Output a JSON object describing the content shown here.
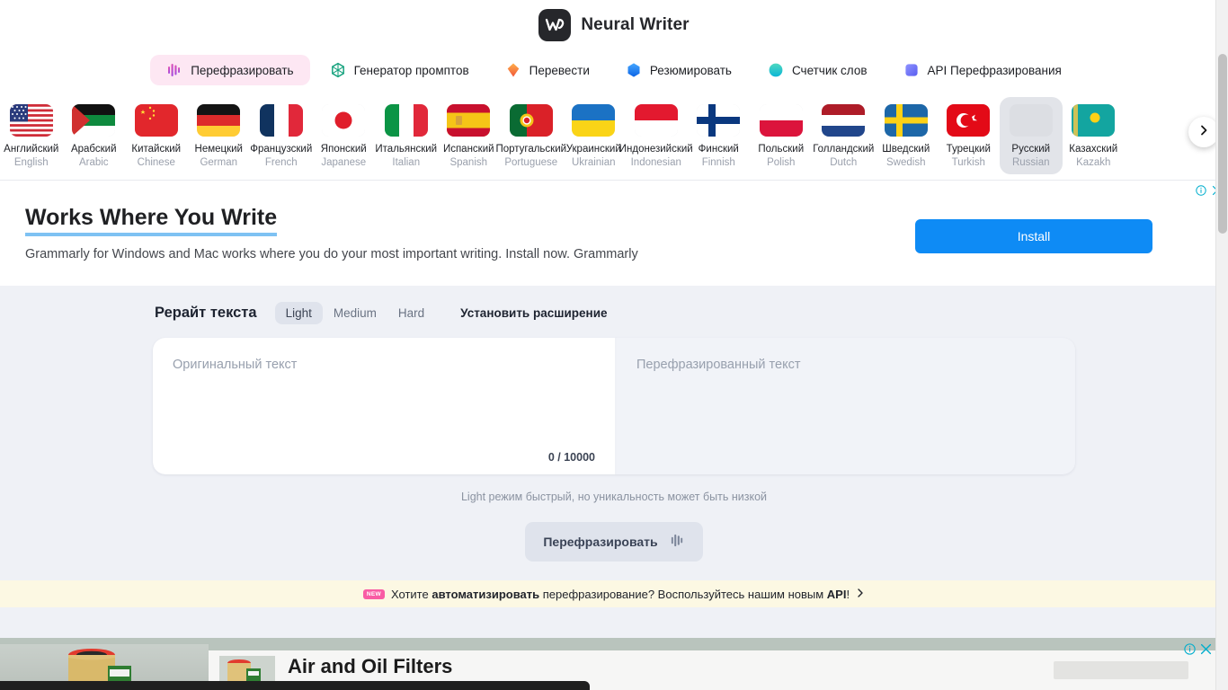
{
  "header": {
    "brand": "Neural Writer",
    "logo_icon": "neural-writer-logo"
  },
  "tabs": [
    {
      "label": "Перефразировать",
      "icon": "paraphrase-icon",
      "active": true
    },
    {
      "label": "Генератор промптов",
      "icon": "prompt-generator-icon",
      "active": false
    },
    {
      "label": "Перевести",
      "icon": "translate-icon",
      "active": false
    },
    {
      "label": "Резюмировать",
      "icon": "summarize-icon",
      "active": false
    },
    {
      "label": "Счетчик слов",
      "icon": "word-counter-icon",
      "active": false
    },
    {
      "label": "API Перефразирования",
      "icon": "api-icon",
      "active": false
    }
  ],
  "languages": [
    {
      "ru": "Английский",
      "en": "English",
      "flag": "us",
      "selected": false
    },
    {
      "ru": "Арабский",
      "en": "Arabic",
      "flag": "ps",
      "selected": false
    },
    {
      "ru": "Китайский",
      "en": "Chinese",
      "flag": "cn",
      "selected": false
    },
    {
      "ru": "Немецкий",
      "en": "German",
      "flag": "de",
      "selected": false
    },
    {
      "ru": "Французский",
      "en": "French",
      "flag": "fr",
      "selected": false
    },
    {
      "ru": "Японский",
      "en": "Japanese",
      "flag": "jp",
      "selected": false
    },
    {
      "ru": "Итальянский",
      "en": "Italian",
      "flag": "it",
      "selected": false
    },
    {
      "ru": "Испанский",
      "en": "Spanish",
      "flag": "es",
      "selected": false
    },
    {
      "ru": "Португальский",
      "en": "Portuguese",
      "flag": "pt",
      "selected": false
    },
    {
      "ru": "Украинский",
      "en": "Ukrainian",
      "flag": "ua",
      "selected": false
    },
    {
      "ru": "Индонезийский",
      "en": "Indonesian",
      "flag": "id",
      "selected": false
    },
    {
      "ru": "Финский",
      "en": "Finnish",
      "flag": "fi",
      "selected": false
    },
    {
      "ru": "Польский",
      "en": "Polish",
      "flag": "pl",
      "selected": false
    },
    {
      "ru": "Голландский",
      "en": "Dutch",
      "flag": "nl",
      "selected": false
    },
    {
      "ru": "Шведский",
      "en": "Swedish",
      "flag": "se",
      "selected": false
    },
    {
      "ru": "Турецкий",
      "en": "Turkish",
      "flag": "tr",
      "selected": false
    },
    {
      "ru": "Русский",
      "en": "Russian",
      "flag": "ru",
      "selected": true
    },
    {
      "ru": "Казахский",
      "en": "Kazakh",
      "flag": "kz",
      "selected": false
    }
  ],
  "flags_next_icon": "chevron-right-icon",
  "ad_top": {
    "title": "Works Where You Write",
    "description": "Grammarly for Windows and Mac works where you do your most important writing. Install now. Grammarly",
    "button": "Install",
    "info_icon": "ad-info-icon",
    "close_icon": "ad-close-icon",
    "accent": "#0e8bf5",
    "underline": "#7ec2f3"
  },
  "tool": {
    "title": "Рерайт текста",
    "modes": [
      {
        "label": "Light",
        "active": true
      },
      {
        "label": "Medium",
        "active": false
      },
      {
        "label": "Hard",
        "active": false
      }
    ],
    "extension_link": "Установить расширение",
    "input_placeholder": "Оригинальный текст",
    "output_placeholder": "Перефразированный текст",
    "counter": "0 / 10000",
    "hint": "Light режим быстрый, но уникальность может быть низкой",
    "action_label": "Перефразировать",
    "action_icon": "paraphrase-icon"
  },
  "api_banner": {
    "badge": "NEW",
    "text_1": "Хотите ",
    "bold_1": "автоматизировать",
    "text_2": " перефразирование? Воспользуйтесь нашим новым ",
    "bold_2": "API",
    "text_3": "!",
    "chevron_icon": "chevron-right-icon",
    "background": "#fcf8e3"
  },
  "ad_bottom": {
    "title": "Air and Oil Filters",
    "info_icon": "ad-info-icon",
    "close_icon": "ad-close-icon"
  }
}
